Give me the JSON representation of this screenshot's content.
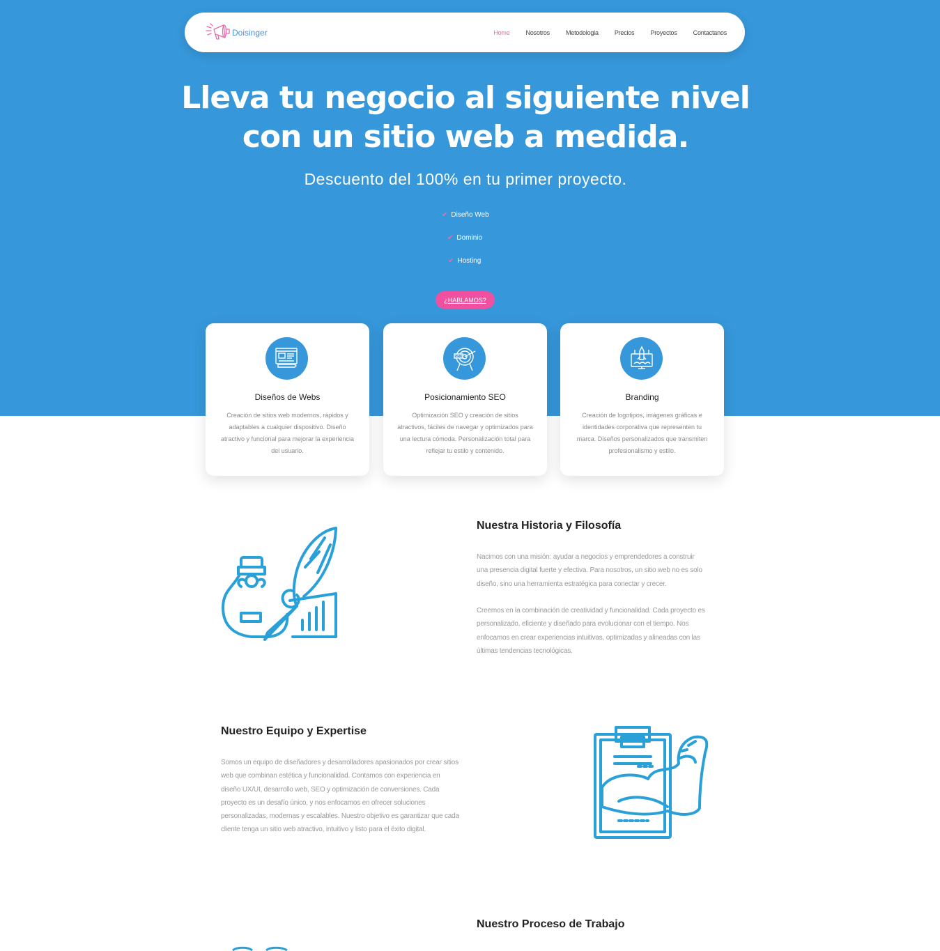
{
  "brand": {
    "name": "Doisinger",
    "logo_icon": "megaphone-icon",
    "accent": "#f26aa0",
    "blue": "#3697da"
  },
  "nav": [
    {
      "label": "Home",
      "active": true
    },
    {
      "label": "Nosotros"
    },
    {
      "label": "Metodologia"
    },
    {
      "label": "Precios"
    },
    {
      "label": "Proyectos"
    },
    {
      "label": "Contactanos"
    }
  ],
  "hero": {
    "title_line1": "Lleva tu negocio al siguiente nivel",
    "title_line2": "con un sitio web a medida.",
    "subtitle": "Descuento del 100% en tu primer proyecto.",
    "checks": [
      "Diseño Web",
      "Dominio",
      "Hosting"
    ],
    "cta": "¿HABLAMOS?"
  },
  "services": [
    {
      "icon": "web-design-icon",
      "title": "Diseños de Webs",
      "text": "Creación de sitios web modernos, rápidos y adaptables a cualquier dispositivo. Diseño atractivo y funcional para mejorar la experiencia del usuario."
    },
    {
      "icon": "seo-target-icon",
      "title": "Posicionamiento SEO",
      "text": "Optimización SEO y creación de sitios atractivos, fáciles de navegar y optimizados para una lectura cómoda. Personalización total para reflejar tu estilo y contenido."
    },
    {
      "icon": "branding-rocket-icon",
      "title": "Branding",
      "text": "Creación de logotipos, imágenes gráficas e identidades corporativa que representen tu marca. Diseños personalizados que transmiten profesionalismo y estilo."
    }
  ],
  "history": {
    "title": "Nuestra Historia y Filosofía",
    "p1": "Nacimos con una misión: ayudar a negocios y emprendedores a construir una presencia digital fuerte y efectiva. Para nosotros, un sitio web no es solo diseño, sino una herramienta estratégica para conectar y crecer.",
    "p2": "Creemos en la combinación de creatividad y funcionalidad. Cada proyecto es personalizado, eficiente y diseñado para evolucionar con el tiempo. Nos enfocamos en crear experiencias intuitivas, optimizadas y alineadas con las últimas tendencias tecnológicas.",
    "icon": "ink-quill-icon"
  },
  "team": {
    "title": "Nuestro Equipo y Expertise",
    "p1": "Somos un equipo de diseñadores y desarrolladores apasionados por crear sitios web que combinan estética y funcionalidad. Contamos con experiencia en diseño UX/UI, desarrollo web, SEO y optimización de conversiones. Cada proyecto es un desafío único, y nos enfocamos en ofrecer soluciones personalizadas, modernas y escalables. Nuestro objetivo es garantizar que cada cliente tenga un sitio web atractivo, intuitivo y listo para el éxito digital.",
    "icon": "clipboard-muscle-icon"
  },
  "process": {
    "title": "Nuestro Proceso de Trabajo"
  }
}
